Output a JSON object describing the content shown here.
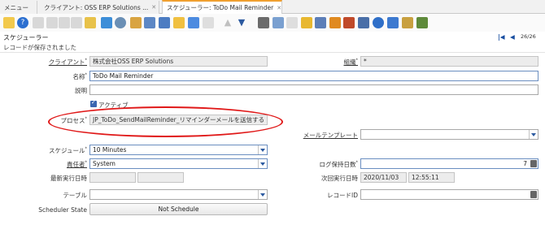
{
  "tabs": [
    {
      "label": "メニュー"
    },
    {
      "label": "クライアント: OSS ERP Solutions ..."
    },
    {
      "label": "スケジューラー: ToDo Mail Reminder",
      "active": true
    }
  ],
  "header": {
    "title": "スケジューラー",
    "page_count": "26/26",
    "status_message": "レコードが保存されました"
  },
  "form": {
    "client": {
      "label": "クライアント",
      "value": "株式会社OSS ERP Solutions"
    },
    "org": {
      "label": "組織",
      "value": "*"
    },
    "name": {
      "label": "名称",
      "value": "ToDo Mail Reminder"
    },
    "description": {
      "label": "説明",
      "value": ""
    },
    "active": {
      "label": "アクティブ",
      "checked": true
    },
    "process": {
      "label": "プロセス",
      "value": "JP_ToDo_SendMailReminder_リマインダーメールを送信する"
    },
    "mail_template": {
      "label": "メールテンプレート",
      "value": ""
    },
    "schedule": {
      "label": "スケジュール",
      "value": "10 Minutes"
    },
    "supervisor": {
      "label": "責任者",
      "value": "System"
    },
    "keep_log_days": {
      "label": "ログ保持日数",
      "value": "7"
    },
    "date_last_run": {
      "label": "最新実行日時",
      "date": "",
      "time": ""
    },
    "date_next_run": {
      "label": "次回実行日時",
      "date": "2020/11/03",
      "time": "12:55:11"
    },
    "table": {
      "label": "テーブル",
      "value": ""
    },
    "record_id": {
      "label": "レコードID",
      "value": ""
    },
    "scheduler_state": {
      "label": "Scheduler State",
      "button": "Not Schedule"
    }
  }
}
